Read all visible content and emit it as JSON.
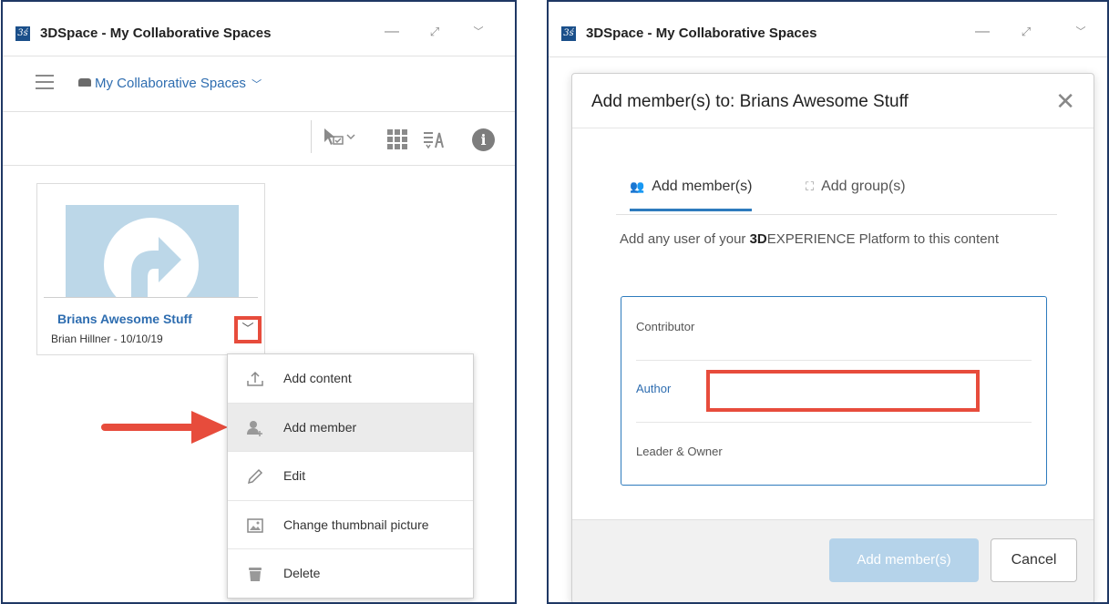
{
  "left": {
    "window_title": "3DSpace - My Collaborative Spaces",
    "nav": {
      "space_selector": "My Collaborative Spaces",
      "chevron": "﹀"
    },
    "card": {
      "title": "Brians Awesome Stuff",
      "meta": "Brian Hillner  - 10/10/19"
    },
    "menu": [
      {
        "label": "Add content",
        "icon": "upload-icon"
      },
      {
        "label": "Add member",
        "icon": "add-member-icon",
        "active": true
      },
      {
        "label": "Edit",
        "icon": "pencil-icon"
      },
      {
        "label": "Change thumbnail picture",
        "icon": "image-icon"
      },
      {
        "label": "Delete",
        "icon": "trash-icon"
      }
    ]
  },
  "right": {
    "window_title": "3DSpace - My Collaborative Spaces",
    "dialog": {
      "title": "Add member(s) to: Brians Awesome Stuff",
      "tabs": [
        "Add member(s)",
        "Add group(s)"
      ],
      "description_bold": "3D",
      "description_rest": "EXPERIENCE Platform to this content",
      "description_prefix": "Add any user of your ",
      "roles": [
        "Contributor",
        "Author",
        "Leader & Owner"
      ],
      "primary_button": "Add member(s)",
      "cancel_button": "Cancel"
    }
  },
  "colors": {
    "accent": "#2e7bbd",
    "link": "#2e6db0",
    "highlight_red": "#e74c3c",
    "panel_border": "#1f3864",
    "primary_disabled": "#b5d3ea"
  }
}
